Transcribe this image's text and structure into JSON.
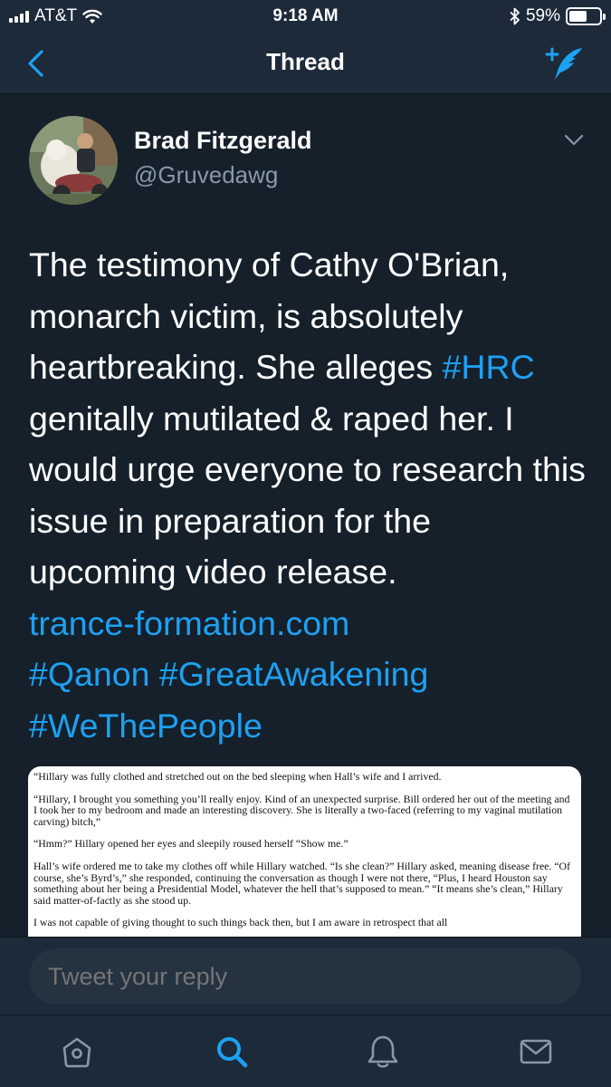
{
  "status_bar": {
    "carrier": "AT&T",
    "time": "9:18 AM",
    "battery": "59%",
    "battery_level": 0.59,
    "icons": [
      "signal-icon",
      "wifi-icon",
      "bluetooth-icon",
      "battery-icon"
    ]
  },
  "nav": {
    "title": "Thread",
    "back_icon": "back-chevron-icon",
    "compose_icon": "compose-reply-icon"
  },
  "tweet": {
    "author_name": "Brad Fitzgerald",
    "author_handle": "@Gruvedawg",
    "text_lines": [
      "The testimony of Cathy O'Brian,",
      "monarch victim, is absolutely",
      "heartbreaking. She alleges ",
      "#HRC",
      "genitally mutilated & raped her. I",
      "would urge everyone to research this",
      "issue in preparation for the",
      "upcoming video release.",
      "trance-formation.com",
      "#Qanon",
      "#GreatAwakening",
      "#WeThePeople"
    ],
    "attachment_paragraphs": [
      "“Hillary was fully clothed and stretched out on the bed sleeping when Hall’s wife and I arrived.",
      "“Hillary, I brought you something you’ll really enjoy. Kind of an unexpected surprise. Bill ordered her out of the meeting and I took her to my bedroom and made an interesting discovery. She is literally a two-faced (referring to my vaginal mutilation carving) bitch,”",
      "“Hmm?” Hillary opened her eyes and sleepily roused herself “Show me.”",
      "Hall’s wife ordered me to take my clothes off while Hillary watched. “Is she clean?” Hillary asked, meaning disease free. “Of course, she’s Byrd’s,” she responded, continuing the conversation as though I were not there, “Plus, I heard Houston say something about her being a Presidential Model, whatever the hell that’s supposed to mean.” “It means she’s clean,” Hillary said matter-of-factly as she stood up.",
      "I was not capable of giving thought to such things back then, but I am aware in retrospect that all"
    ]
  },
  "reply": {
    "placeholder": "Tweet your reply"
  },
  "tab_bar": {
    "items": [
      "home-icon",
      "search-icon",
      "notifications-icon",
      "messages-icon"
    ],
    "active": "search-icon"
  },
  "colors": {
    "background": "#15202b",
    "bar": "#1d2a3a",
    "accent": "#1da1f2",
    "secondary_text": "#8899a6"
  }
}
